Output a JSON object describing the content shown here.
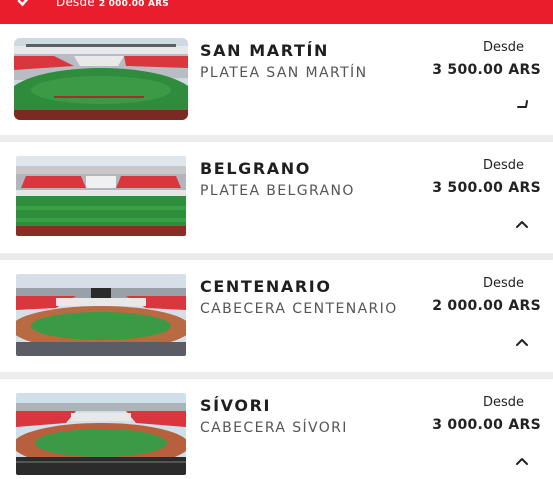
{
  "banner": {
    "label": "Desde",
    "amount": "2 000.00 ARS",
    "check_icon": "check-icon",
    "color": "#ea1d2c"
  },
  "sections": [
    {
      "name": "SAN MARTÍN",
      "subtitle": "PLATEA SAN MARTÍN",
      "from_label": "Desde",
      "price": "3 500.00 ARS",
      "icon": "chevron-icon"
    },
    {
      "name": "BELGRANO",
      "subtitle": "PLATEA BELGRANO",
      "from_label": "Desde",
      "price": "3 500.00 ARS",
      "icon": "chevron-up-icon"
    },
    {
      "name": "CENTENARIO",
      "subtitle": "CABECERA CENTENARIO",
      "from_label": "Desde",
      "price": "2 000.00 ARS",
      "icon": "chevron-up-icon"
    },
    {
      "name": "SÍVORI",
      "subtitle": "CABECERA SÍVORI",
      "from_label": "Desde",
      "price": "3 000.00 ARS",
      "icon": "chevron-up-icon"
    }
  ]
}
